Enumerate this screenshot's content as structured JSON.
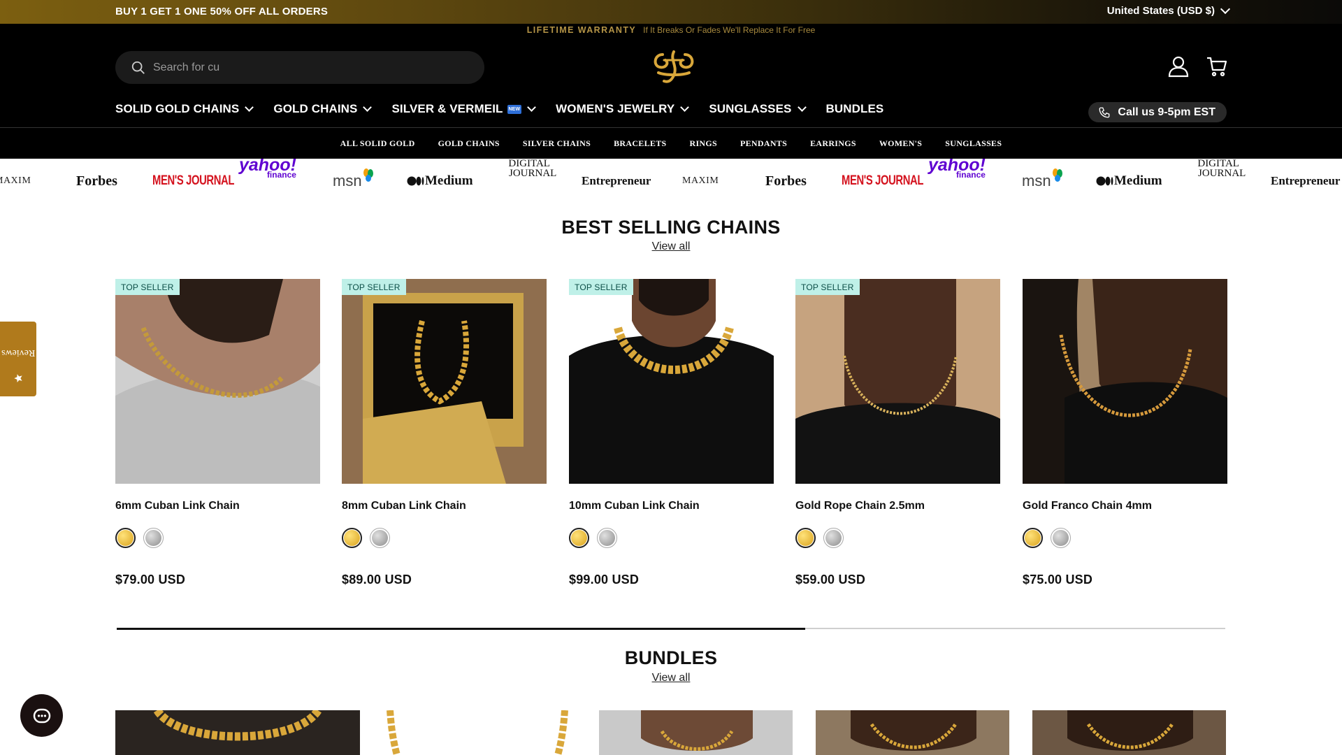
{
  "announcement": {
    "promo": "BUY 1 GET 1 ONE 50% OFF ALL ORDERS",
    "region": "United States (USD $)"
  },
  "warranty": {
    "title": "LIFETIME WARRANTY",
    "text": "If It Breaks Or Fades We'll Replace It For Free"
  },
  "search": {
    "placeholder": "Search for cu"
  },
  "icons": {
    "search": "search-icon",
    "account": "account-icon",
    "cart": "cart-icon",
    "phone": "phone-icon",
    "logo": "logo-icon",
    "reviews": "star-icon",
    "chat": "chat-icon"
  },
  "main_nav": [
    {
      "label": "SOLID GOLD CHAINS",
      "dropdown": true
    },
    {
      "label": "GOLD CHAINS",
      "dropdown": true
    },
    {
      "label": "SILVER & VERMEIL",
      "dropdown": true,
      "badge": "NEW"
    },
    {
      "label": "WOMEN'S JEWELRY",
      "dropdown": true
    },
    {
      "label": "SUNGLASSES",
      "dropdown": true
    },
    {
      "label": "BUNDLES",
      "dropdown": false
    }
  ],
  "call_button": "Call us 9-5pm EST",
  "sub_nav": [
    "ALL SOLID GOLD",
    "GOLD CHAINS",
    "SILVER CHAINS",
    "BRACELETS",
    "RINGS",
    "PENDANTS",
    "EARRINGS",
    "WOMEN'S",
    "SUNGLASSES"
  ],
  "press": [
    "MAXIM",
    "Forbes",
    "MEN'S JOURNAL",
    "yahoo!",
    "finance",
    "msn",
    "Medium",
    "DIGITAL",
    "JOURNAL",
    "Entrepreneur"
  ],
  "best_selling": {
    "title": "BEST SELLING CHAINS",
    "view_all": "View all",
    "products": [
      {
        "tag": "TOP SELLER",
        "name": "6mm Cuban Link Chain",
        "price": "$79.00 USD"
      },
      {
        "tag": "TOP SELLER",
        "name": "8mm Cuban Link Chain",
        "price": "$89.00 USD"
      },
      {
        "tag": "TOP SELLER",
        "name": "10mm Cuban Link Chain",
        "price": "$99.00 USD"
      },
      {
        "tag": "TOP SELLER",
        "name": "Gold Rope Chain 2.5mm",
        "price": "$59.00 USD"
      },
      {
        "name": "Gold Franco Chain 4mm",
        "price": "$75.00 USD"
      }
    ],
    "scroll_progress": 0.62
  },
  "bundles": {
    "title": "BUNDLES",
    "view_all": "View all"
  },
  "reviews_tab": "Reviews",
  "colors": {
    "gold": "#e0b22c",
    "silver": "#a7a7a7",
    "tag_bg": "#bff0e8",
    "accent_gold": "#b07a1c"
  }
}
